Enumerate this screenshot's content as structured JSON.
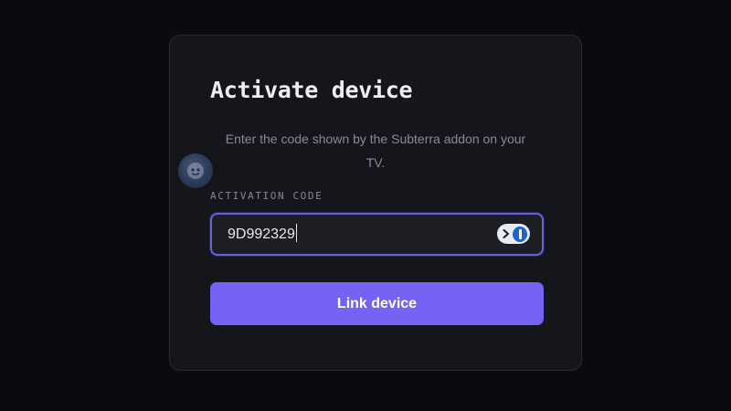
{
  "activation": {
    "title": "Activate device",
    "description": "Enter the code shown by the Subterra addon on your TV.",
    "code_label": "ACTIVATION CODE",
    "code_value": "9D992329",
    "submit_label": "Link device"
  },
  "colors": {
    "background": "#0b0b0f",
    "card": "#15151c",
    "accent": "#7463f4",
    "field_border": "#6d5ee0"
  },
  "icons": {
    "field_badge": "robot-face-icon",
    "password_manager": "onepassword-icon",
    "autofill_arrow": "chevron-right-icon"
  }
}
